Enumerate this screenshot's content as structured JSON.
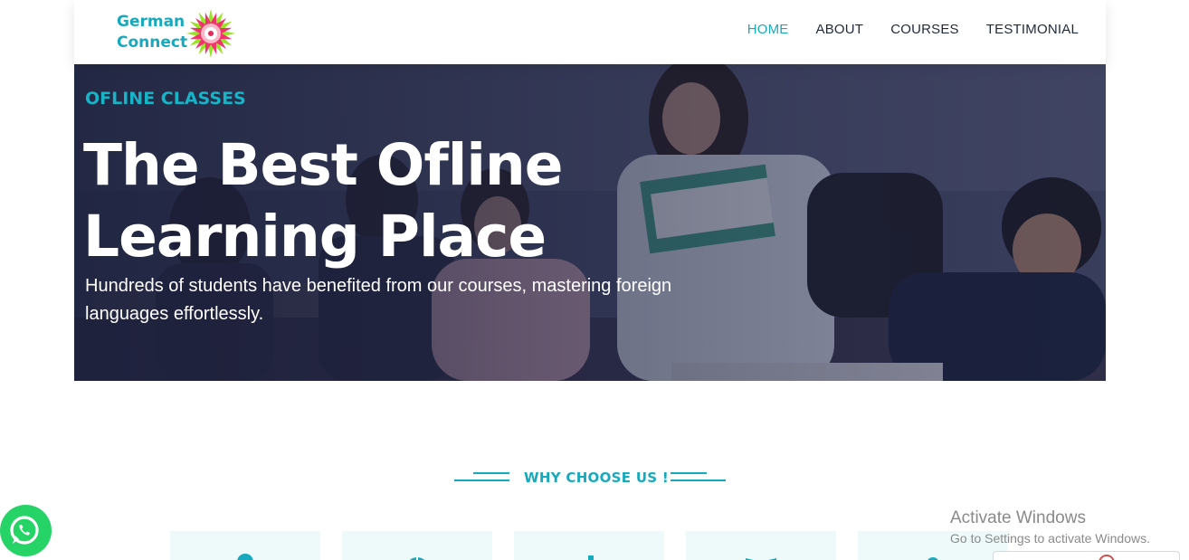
{
  "brand": {
    "line1": "German",
    "line2": "Connect"
  },
  "nav": {
    "items": [
      {
        "label": "HOME",
        "active": true
      },
      {
        "label": "ABOUT",
        "active": false
      },
      {
        "label": "COURSES",
        "active": false
      },
      {
        "label": "TESTIMONIAL",
        "active": false
      }
    ]
  },
  "hero": {
    "eyebrow": "OFLINE CLASSES",
    "title": "The Best Ofline Learning Place",
    "subtitle": "Hundreds of students have benefited from our courses, mastering foreign languages effortlessly."
  },
  "section": {
    "why_title": "WHY CHOOSE US !"
  },
  "features": [
    {
      "icon": "user-icon"
    },
    {
      "icon": "globe-icon"
    },
    {
      "icon": "building-icon"
    },
    {
      "icon": "book-icon"
    },
    {
      "icon": "user-icon"
    }
  ],
  "windows_watermark": {
    "title": "Activate Windows",
    "subtitle": "Go to Settings to activate Windows."
  },
  "colors": {
    "accent": "#17a9bd",
    "nav_text": "#1f2a3c",
    "hero_overlay": "#181d38",
    "feature_bg": "#eefafa",
    "whatsapp": "#25d366"
  }
}
